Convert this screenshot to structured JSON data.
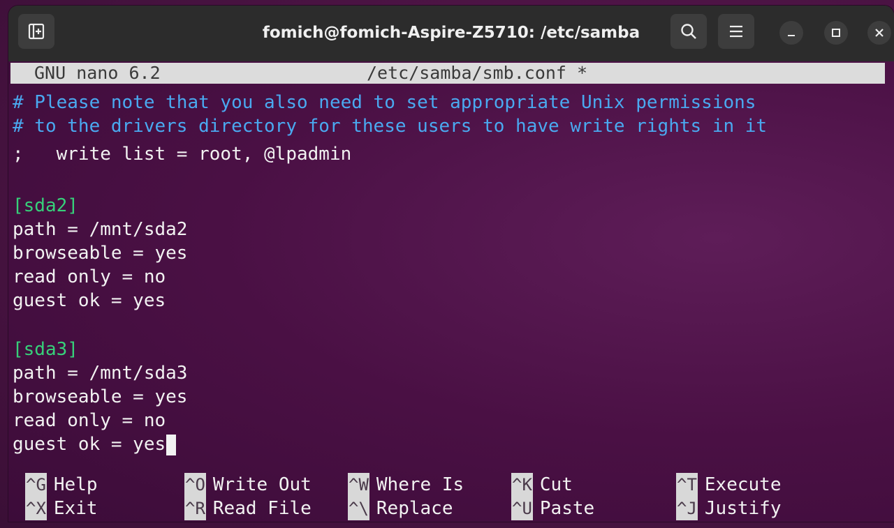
{
  "window": {
    "title": "fomich@fomich-Aspire-Z5710: /etc/samba"
  },
  "icons": {
    "new_tab": "new-tab-icon",
    "search": "search-icon",
    "menu": "hamburger-menu-icon",
    "minimize": "minimize-icon",
    "maximize": "maximize-icon",
    "close": "close-icon"
  },
  "nano": {
    "version": "GNU nano 6.2",
    "filename": "/etc/samba/smb.conf *"
  },
  "lines": [
    {
      "text": "# Please note that you also need to set appropriate Unix permissions",
      "kind": "comment"
    },
    {
      "text": "# to the drivers directory for these users to have write rights in it",
      "kind": "comment"
    },
    {
      "text": ";   write list = root, @lpadmin",
      "kind": "normal"
    },
    {
      "text": "",
      "kind": "normal"
    },
    {
      "text": "[sda2]",
      "kind": "section"
    },
    {
      "text": "path = /mnt/sda2",
      "kind": "normal"
    },
    {
      "text": "browseable = yes",
      "kind": "normal"
    },
    {
      "text": "read only = no",
      "kind": "normal"
    },
    {
      "text": "guest ok = yes",
      "kind": "normal"
    },
    {
      "text": "",
      "kind": "normal"
    },
    {
      "text": "[sda3]",
      "kind": "section"
    },
    {
      "text": "path = /mnt/sda3",
      "kind": "normal"
    },
    {
      "text": "browseable = yes",
      "kind": "normal"
    },
    {
      "text": "read only = no",
      "kind": "normal"
    },
    {
      "text": "guest ok = yes",
      "kind": "normal"
    }
  ],
  "shortcuts": [
    {
      "key": "^G",
      "label": "Help"
    },
    {
      "key": "^X",
      "label": "Exit"
    },
    {
      "key": "^O",
      "label": "Write Out"
    },
    {
      "key": "^R",
      "label": "Read File"
    },
    {
      "key": "^W",
      "label": "Where Is"
    },
    {
      "key": "^\\",
      "label": "Replace"
    },
    {
      "key": "^K",
      "label": "Cut"
    },
    {
      "key": "^U",
      "label": "Paste"
    },
    {
      "key": "^T",
      "label": "Execute"
    },
    {
      "key": "^J",
      "label": "Justify"
    }
  ],
  "colors": {
    "comment": "#4aa9f0",
    "section": "#37d07a",
    "background": "#4a1044",
    "titlebar": "#2c2c2c"
  }
}
